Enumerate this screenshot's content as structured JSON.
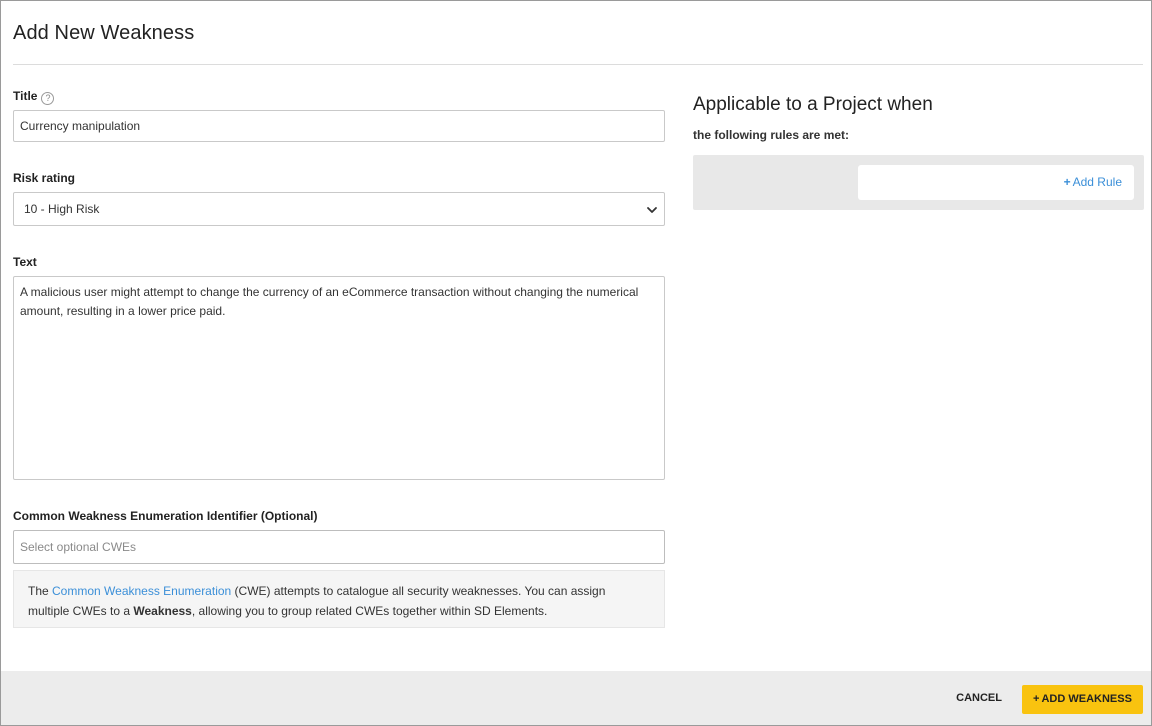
{
  "dialog": {
    "title": "Add New Weakness"
  },
  "form": {
    "title_label": "Title",
    "title_help_icon": "?",
    "title_value": "Currency manipulation",
    "risk_label": "Risk rating",
    "risk_value": "10 - High Risk",
    "text_label": "Text",
    "text_value": "A malicious user might attempt to change the currency of an eCommerce transaction without changing the numerical amount, resulting in a lower price paid.",
    "cwe_label": "Common Weakness Enumeration Identifier (Optional)",
    "cwe_placeholder": "Select optional CWEs",
    "info": {
      "part1": "The ",
      "link": "Common Weakness Enumeration",
      "part2": " (CWE) attempts to catalogue all security weaknesses. You can assign multiple CWEs to a ",
      "bold": "Weakness",
      "part3": ", allowing you to group related CWEs together within SD Elements."
    }
  },
  "rules": {
    "heading": "Applicable to a Project when",
    "subtitle": "the following rules are met:",
    "add_rule_icon": "+",
    "add_rule_label": "Add Rule"
  },
  "footer": {
    "cancel_label": "CANCEL",
    "add_icon": "+",
    "add_label": "ADD WEAKNESS"
  },
  "colors": {
    "accent_link": "#3b8fd8",
    "primary_button": "#f9c30f",
    "footer_bg": "#ececec",
    "panel_bg": "#e8e8e8"
  }
}
